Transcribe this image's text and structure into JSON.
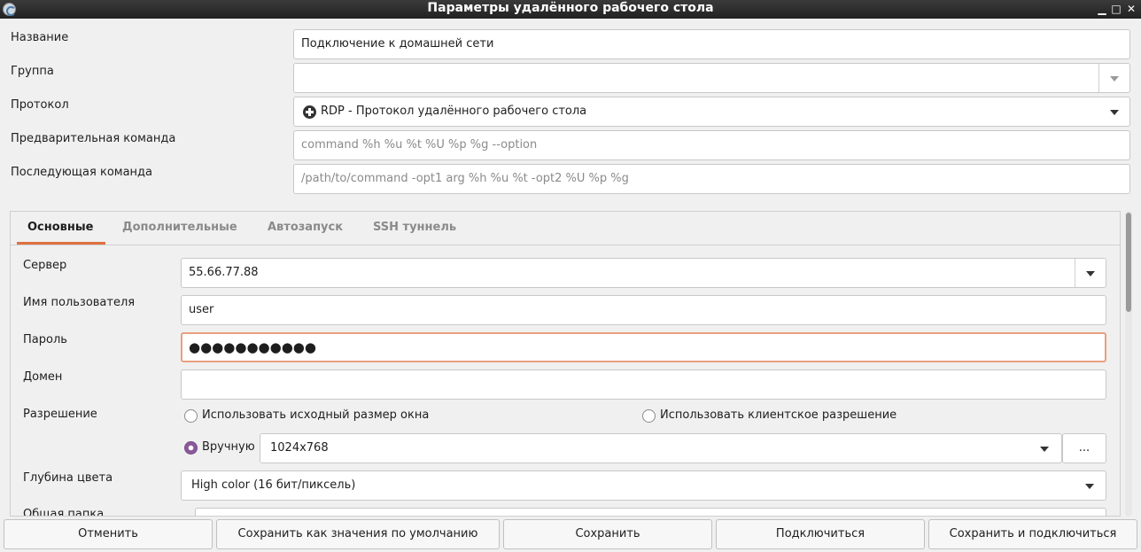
{
  "window": {
    "title": "Параметры удалённого рабочего стола",
    "minimize_glyph": "▁",
    "maximize_glyph": "□",
    "close_glyph": "✕"
  },
  "form": {
    "name_label": "Название",
    "name_value": "Подключение к домашней сети",
    "group_label": "Группа",
    "group_value": "",
    "protocol_label": "Протокол",
    "protocol_value": "RDP - Протокол удалённого рабочего стола",
    "precommand_label": "Предварительная команда",
    "precommand_placeholder": "command %h %u %t %U %p %g --option",
    "postcommand_label": "Последующая команда",
    "postcommand_placeholder": "/path/to/command -opt1 arg %h %u %t -opt2 %U %p %g"
  },
  "tabs": [
    "Основные",
    "Дополнительные",
    "Автозапуск",
    "SSH туннель"
  ],
  "basic": {
    "server_label": "Сервер",
    "server_value": "55.66.77.88",
    "username_label": "Имя пользователя",
    "username_value": "user",
    "password_label": "Пароль",
    "password_value": "●●●●●●●●●●●",
    "domain_label": "Домен",
    "domain_value": "",
    "resolution_label": "Разрешение",
    "res_option_window": "Использовать исходный размер окна",
    "res_option_client": "Использовать клиентское разрешение",
    "res_option_manual": "Вручную",
    "res_manual_value": "1024x768",
    "res_more_button": "...",
    "colordepth_label": "Глубина цвета",
    "colordepth_value": "High color (16 бит/пиксель)",
    "shared_folder_label": "Общая папка"
  },
  "buttons": {
    "cancel": "Отменить",
    "save_default": "Сохранить как значения по умолчанию",
    "save": "Сохранить",
    "connect": "Подключиться",
    "save_connect": "Сохранить и подключиться"
  },
  "colors": {
    "tab_accent": "#e07040",
    "focus_border": "#e8a080",
    "radio_checked": "#8a5a9a"
  }
}
